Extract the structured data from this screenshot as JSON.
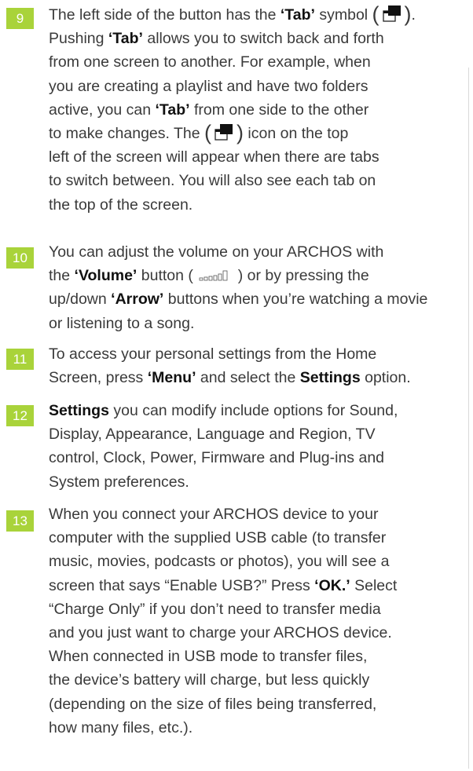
{
  "items": [
    {
      "number": "9",
      "lines": [
        [
          "The left side of the button has the ",
          {
            "b": "‘Tab’"
          },
          " symbol ",
          {
            "paren": "("
          },
          {
            "icon": "tab-icon"
          },
          {
            "paren": ")"
          },
          "."
        ],
        [
          "Pushing ",
          {
            "b": "‘Tab’"
          },
          " allows you to switch back and forth"
        ],
        [
          "from one screen to another. For example, when"
        ],
        [
          "you are creating a playlist and have two folders"
        ],
        [
          "active, you can ",
          {
            "b": "‘Tab’"
          },
          " from one side to the other"
        ],
        [
          "to make changes. The ",
          {
            "paren": "("
          },
          {
            "icon": "tab-icon"
          },
          {
            "paren": ")"
          },
          " icon on the top"
        ],
        [
          "left of the screen will appear when there are tabs"
        ],
        [
          "to switch between. You will also see each tab on"
        ],
        [
          "the top of the screen."
        ]
      ]
    },
    {
      "number": "10",
      "lines": [
        [
          "You can adjust the volume on your ARCHOS with"
        ],
        [
          "the ",
          {
            "b": "‘Volume’"
          },
          " button ( ",
          {
            "icon": "volume-icon"
          },
          " ) or by pressing the"
        ],
        [
          "up/down ",
          {
            "b": "‘Arrow’"
          },
          " buttons when you’re watching a movie"
        ],
        [
          "or listening to a song."
        ]
      ]
    },
    {
      "number": "11",
      "lines": [
        [
          "To access your personal settings from the Home"
        ],
        [
          "Screen, press ",
          {
            "b": "‘Menu’"
          },
          " and select the ",
          {
            "b": "Settings"
          },
          " option."
        ]
      ]
    },
    {
      "number": "12",
      "lines": [
        [
          {
            "b": "Settings"
          },
          " you can modify include options for Sound,"
        ],
        [
          "Display, Appearance, Language and Region, TV"
        ],
        [
          "control, Clock, Power, Firmware and Plug-ins and"
        ],
        [
          "System preferences."
        ]
      ]
    },
    {
      "number": "13",
      "lines": [
        [
          "When you connect your ARCHOS device to your"
        ],
        [
          "computer with the supplied USB cable (to transfer"
        ],
        [
          "music, movies, podcasts or photos), you will see a"
        ],
        [
          "screen that says “Enable USB?” Press ",
          {
            "b": "‘OK.’"
          },
          " Select"
        ],
        [
          "“Charge Only” if you don’t need to transfer media"
        ],
        [
          "and you just want to charge your ARCHOS device."
        ],
        [
          "When connected in USB mode to transfer files,"
        ],
        [
          "the device’s battery will charge, but less quickly"
        ],
        [
          "(depending on the size of files being transferred,"
        ],
        [
          "how many files, etc.)."
        ]
      ]
    }
  ],
  "colors": {
    "badge": "#a9d33a",
    "text": "#3a3a3a",
    "bold": "#111111"
  }
}
